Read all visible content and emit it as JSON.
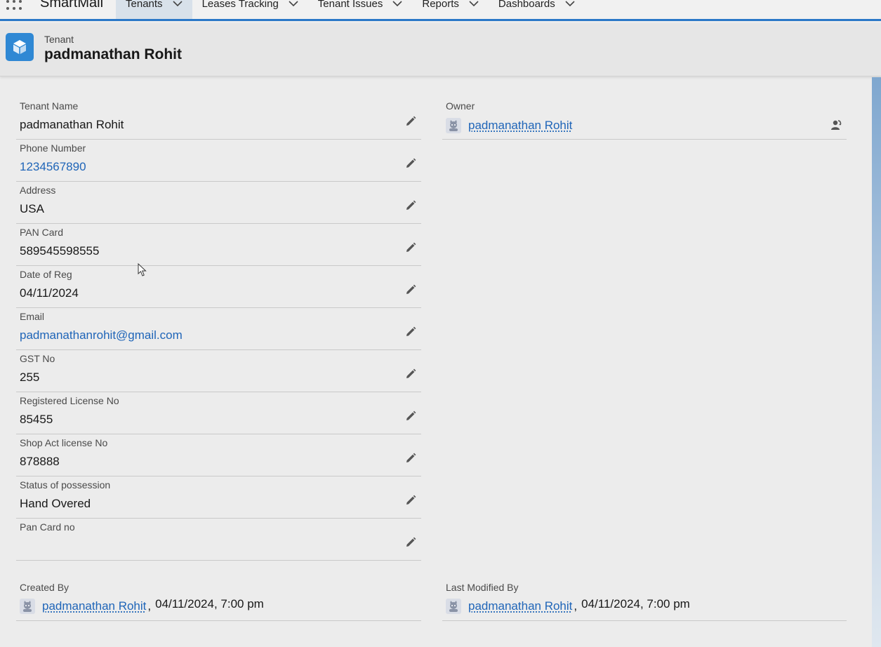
{
  "app": {
    "name": "SmartMall",
    "nav_tabs": [
      {
        "label": "Tenants",
        "active": true
      },
      {
        "label": "Leases Tracking",
        "active": false
      },
      {
        "label": "Tenant Issues",
        "active": false
      },
      {
        "label": "Reports",
        "active": false
      },
      {
        "label": "Dashboards",
        "active": false
      }
    ]
  },
  "header": {
    "object_type": "Tenant",
    "record_title": "padmanathan Rohit",
    "icon": "cube-icon"
  },
  "colors": {
    "accent": "#2a78c8",
    "link": "#1f65b8",
    "object_icon_bg": "#2f88d4"
  },
  "fields": [
    {
      "label": "Tenant Name",
      "value": "padmanathan Rohit",
      "link": false
    },
    {
      "label": "Phone Number",
      "value": "1234567890",
      "link": true
    },
    {
      "label": "Address",
      "value": "USA",
      "link": false
    },
    {
      "label": "PAN Card",
      "value": "589545598555",
      "link": false
    },
    {
      "label": "Date of Reg",
      "value": "04/11/2024",
      "link": false
    },
    {
      "label": "Email",
      "value": "padmanathanrohit@gmail.com",
      "link": true
    },
    {
      "label": "GST No",
      "value": "255",
      "link": false
    },
    {
      "label": "Registered License No",
      "value": "85455",
      "link": false
    },
    {
      "label": "Shop Act license No",
      "value": "878888",
      "link": false
    },
    {
      "label": "Status of possession",
      "value": "Hand Overed",
      "link": false
    },
    {
      "label": "Pan Card no",
      "value": "",
      "link": false
    }
  ],
  "owner": {
    "label": "Owner",
    "name": "padmanathan Rohit"
  },
  "system": {
    "created_by": {
      "label": "Created By",
      "name": "padmanathan Rohit",
      "sep": ",",
      "timestamp": "04/11/2024, 7:00 pm"
    },
    "last_modified_by": {
      "label": "Last Modified By",
      "name": "padmanathan Rohit",
      "sep": ",",
      "timestamp": "04/11/2024, 7:00 pm"
    }
  }
}
